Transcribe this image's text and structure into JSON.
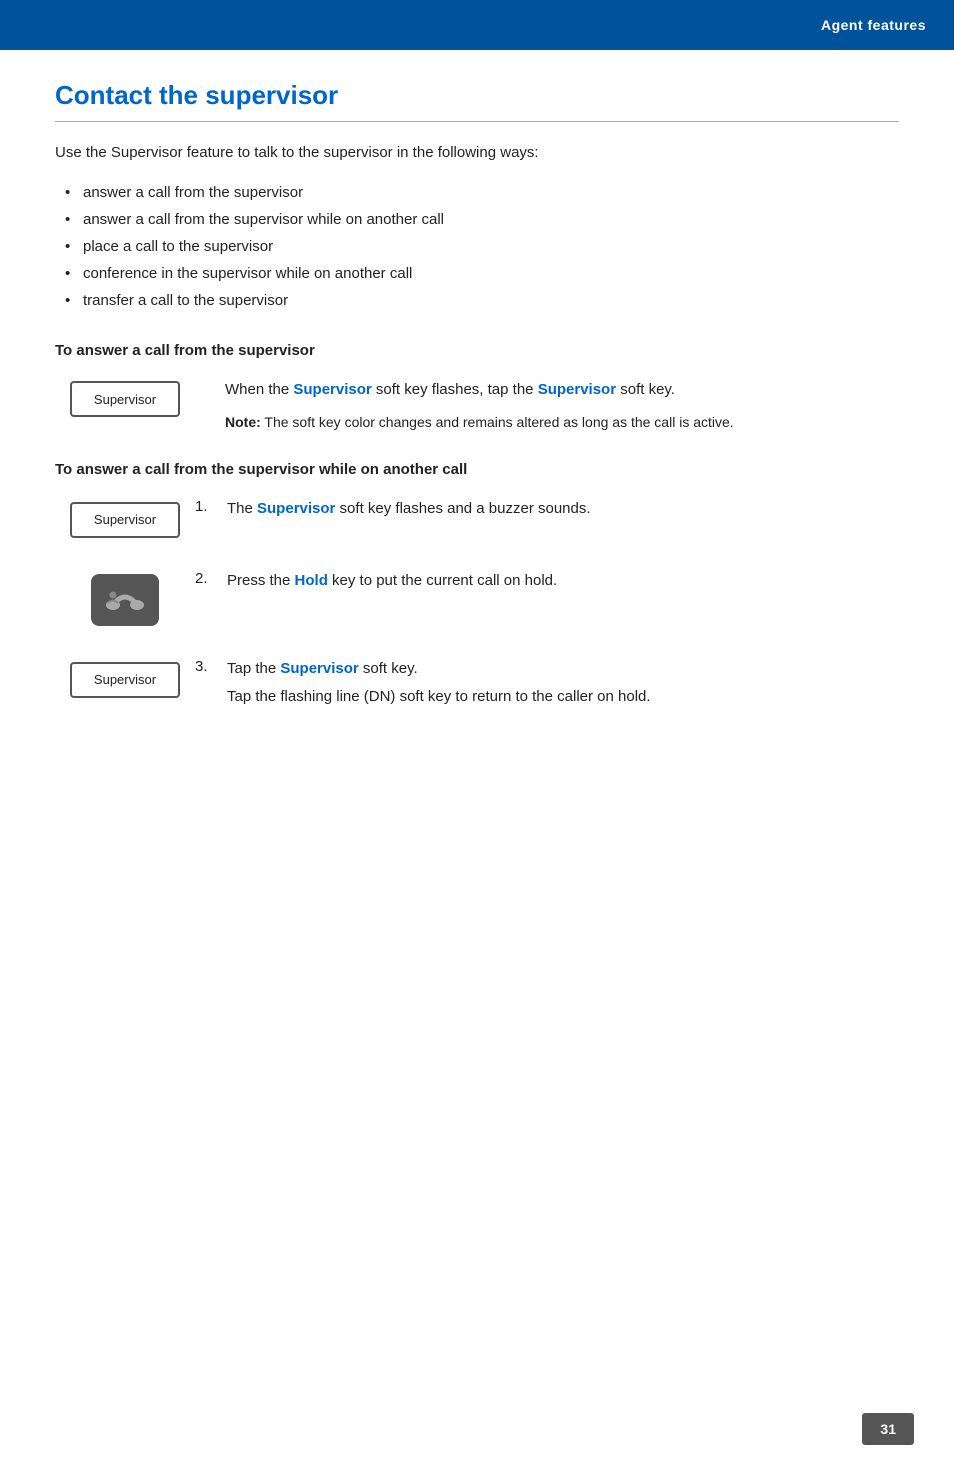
{
  "header": {
    "title": "Agent features",
    "background_color": "#00529b"
  },
  "page": {
    "heading": "Contact the supervisor",
    "intro": "Use the Supervisor feature to talk to the supervisor in the following ways:",
    "bullets": [
      "answer a call from the supervisor",
      "answer a call from the supervisor while on another call",
      "place a call to the supervisor",
      "conference in the supervisor while on another call",
      "transfer a call to the supervisor"
    ]
  },
  "section1": {
    "heading": "To answer a call from the supervisor",
    "softkey_label": "Supervisor",
    "description_part1": "When the ",
    "description_bold1": "Supervisor",
    "description_part2": " soft key flashes, tap the ",
    "description_bold2": "Supervisor",
    "description_part3": " soft key.",
    "note_bold": "Note:",
    "note_text": " The soft key color changes and remains altered as long as the call is active."
  },
  "section2": {
    "heading": "To answer a call from the supervisor while on another call",
    "steps": [
      {
        "num": "1.",
        "icon_type": "supervisor",
        "softkey_label": "Supervisor",
        "desc_part1": "The ",
        "desc_bold1": "Supervisor",
        "desc_part2": " soft key flashes and a buzzer sounds."
      },
      {
        "num": "2.",
        "icon_type": "hold",
        "desc_part1": "Press the ",
        "desc_bold1": "Hold",
        "desc_part2": " key to put the current call on hold."
      },
      {
        "num": "3.",
        "icon_type": "supervisor",
        "softkey_label": "Supervisor",
        "desc_part1": "Tap the ",
        "desc_bold1": "Supervisor",
        "desc_part2": " soft key.",
        "sub_text": "Tap the flashing line (DN) soft key to return to the caller on hold."
      }
    ]
  },
  "footer": {
    "page_number": "31"
  }
}
